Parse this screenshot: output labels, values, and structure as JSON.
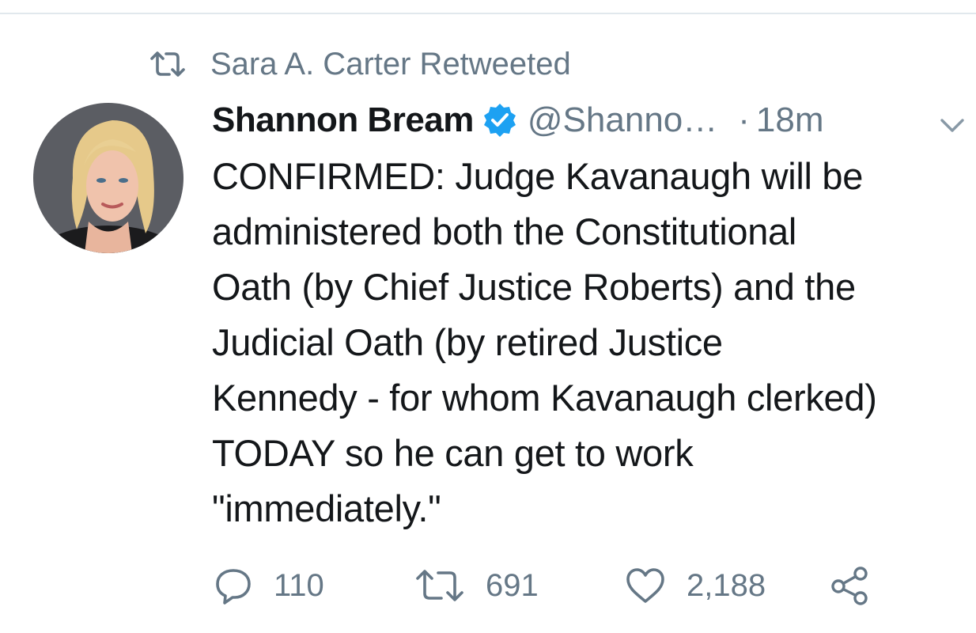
{
  "retweet_banner": {
    "icon": "retweet-icon",
    "text": "Sara A. Carter Retweeted"
  },
  "tweet": {
    "author": {
      "name": "Shannon Bream",
      "verified": true,
      "handle": "@Shanno…",
      "avatar": "avatar-photo"
    },
    "separator": "·",
    "time": "18m",
    "menu_icon": "chevron-down-icon",
    "text": "CONFIRMED:  Judge Kavanaugh will be\nadministered both the Constitutional\nOath (by Chief Justice Roberts) and the\nJudicial Oath (by retired Justice\nKennedy - for whom Kavanaugh clerked)\nTODAY so he can get to work\n\"immediately.\"",
    "actions": {
      "reply": {
        "icon": "reply-icon",
        "count": "110"
      },
      "retweet": {
        "icon": "retweet-icon",
        "count": "691"
      },
      "like": {
        "icon": "heart-icon",
        "count": "2,188"
      },
      "share": {
        "icon": "share-icon"
      }
    }
  },
  "colors": {
    "text": "#14171a",
    "secondary": "#657786",
    "verified": "#1da1f2",
    "divider": "#e1e8ed"
  }
}
